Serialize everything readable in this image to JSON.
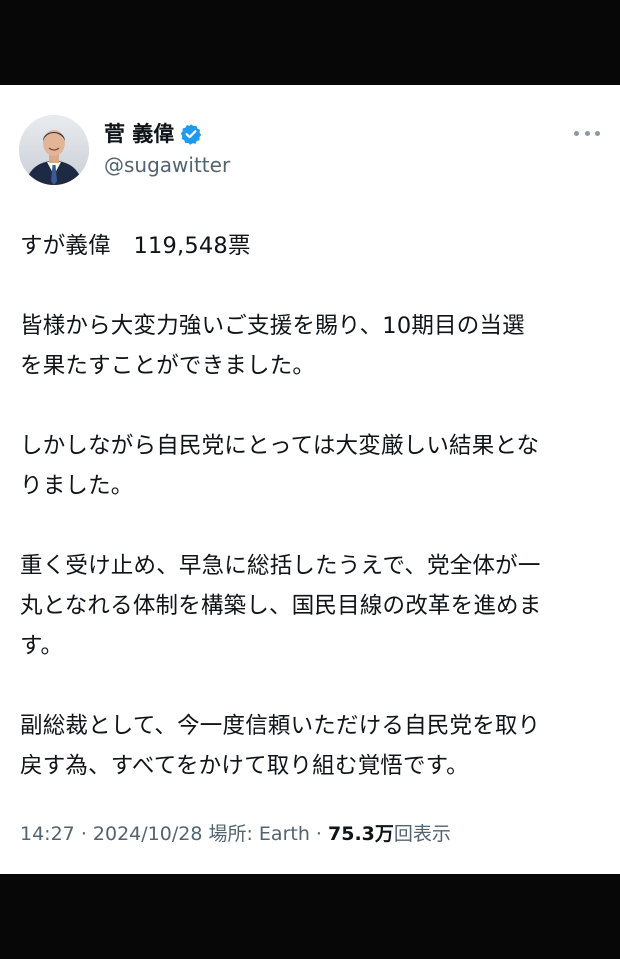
{
  "colors": {
    "background": "#000000",
    "card": "#ffffff",
    "text_primary": "#0f1419",
    "text_secondary": "#536471",
    "verified_badge": "#1d9bf0"
  },
  "author": {
    "display_name": "菅 義偉",
    "handle": "@sugawitter",
    "verified_icon": "verified-badge-icon",
    "avatar_icon": "profile-photo"
  },
  "tweet": {
    "paragraphs": [
      "すが義偉　119,548票",
      "皆様から大変力強いご支援を賜り、10期目の当選\nを果たすことができました。",
      "しかしながら自民党にとっては大変厳しい結果とな\nりました。",
      "重く受け止め、早急に総括したうえで、党全体が一\n丸となれる体制を構築し、国民目線の改革を進めま\nす。",
      "副総裁として、今一度信頼いただける自民党を取り\n戻す為、すべてをかけて取り組む覚悟です。"
    ]
  },
  "meta": {
    "time": "14:27",
    "separator": "·",
    "date": "2024/10/28",
    "location_label": "場所:",
    "location": "Earth",
    "views_count": "75.3万",
    "views_label": "回表示"
  },
  "menu": {
    "more_icon": "more-options-icon"
  }
}
